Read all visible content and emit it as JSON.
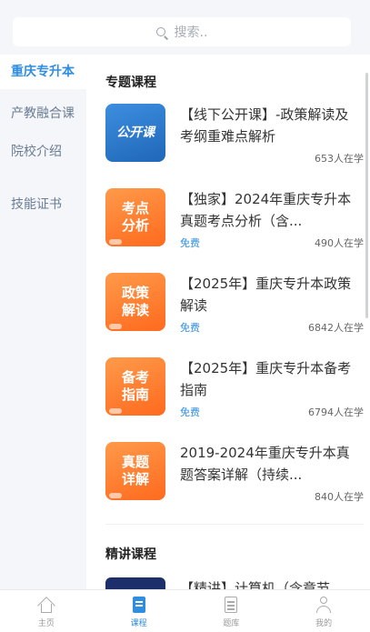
{
  "search": {
    "placeholder": "搜索.."
  },
  "sidebar": {
    "items": [
      {
        "label": "重庆专升本"
      },
      {
        "label": "产教融合课"
      },
      {
        "label": "院校介绍"
      },
      {
        "label": "技能证书"
      }
    ]
  },
  "sections": {
    "special": "专题课程",
    "featured": "精讲课程"
  },
  "courses": [
    {
      "thumb": "公开课",
      "title": "【线下公开课】-政策解读及考纲重难点解析",
      "free": "",
      "count": "653人在学"
    },
    {
      "thumb": "考点\n分析",
      "title": "【独家】2024年重庆专升本真题考点分析（含...",
      "free": "免费",
      "count": "490人在学"
    },
    {
      "thumb": "政策\n解读",
      "title": "【2025年】重庆专升本政策解读",
      "free": "免费",
      "count": "6842人在学"
    },
    {
      "thumb": "备考\n指南",
      "title": "【2025年】重庆专升本备考指南",
      "free": "免费",
      "count": "6794人在学"
    },
    {
      "thumb": "真题\n详解",
      "title": "2019-2024年重庆专升本真题答案详解（持续...",
      "free": "",
      "count": "840人在学"
    }
  ],
  "partial_course": {
    "title": "【精讲】计算机（含章节"
  },
  "tabbar": {
    "tabs": [
      {
        "label": "主页",
        "icon": "home-icon"
      },
      {
        "label": "课程",
        "icon": "course-icon"
      },
      {
        "label": "题库",
        "icon": "question-bank-icon"
      },
      {
        "label": "我的",
        "icon": "profile-icon"
      }
    ]
  },
  "colors": {
    "accent": "#2f8ee0",
    "thumb_orange": "#ff7a2a",
    "thumb_blue": "#2a76c8"
  }
}
